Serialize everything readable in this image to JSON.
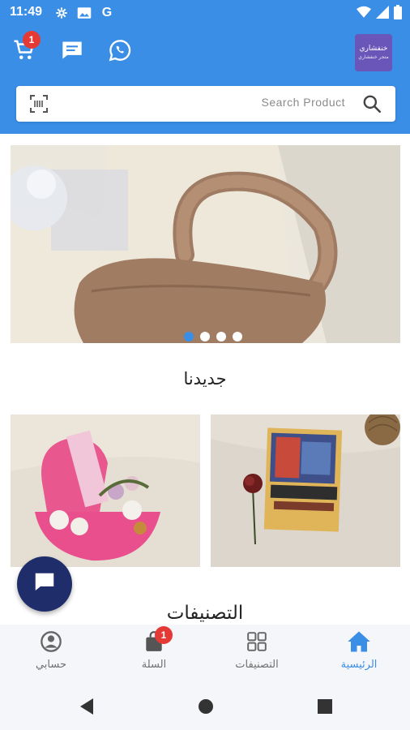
{
  "status_bar": {
    "time": "11:49",
    "icons": [
      "gear-icon",
      "image-icon",
      "google-icon",
      "wifi-icon",
      "signal-icon",
      "battery-icon"
    ]
  },
  "header": {
    "cart_badge": "1",
    "logo_text": "خنفشاري",
    "logo_subtext": "متجر خنفشاري",
    "icons": [
      "cart-icon",
      "chat-icon",
      "whatsapp-icon"
    ]
  },
  "search": {
    "placeholder": "Search Product"
  },
  "banner": {
    "slides": 4,
    "active_slide": 0
  },
  "sections": {
    "new_title": "جديدنا",
    "categories_title": "التصنيفات"
  },
  "bottom_nav": {
    "items": [
      {
        "label": "حسابي",
        "icon": "account-icon"
      },
      {
        "label": "السلة",
        "icon": "bag-icon",
        "badge": "1"
      },
      {
        "label": "التصنيفات",
        "icon": "grid-icon"
      },
      {
        "label": "الرئيسية",
        "icon": "home-icon"
      }
    ],
    "active_index": 3
  },
  "colors": {
    "primary": "#3a8ee6",
    "fab": "#1f2d6b",
    "badge": "#e53935"
  }
}
